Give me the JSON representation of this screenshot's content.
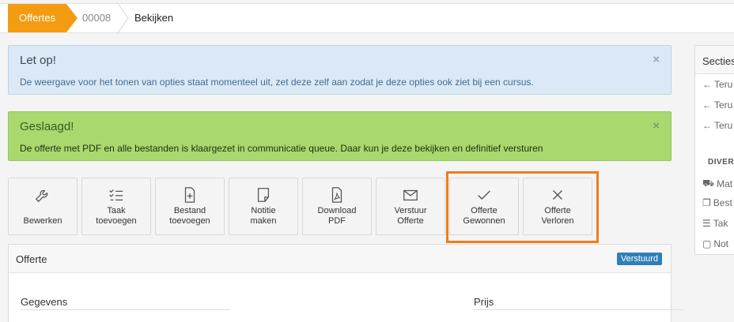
{
  "breadcrumb": {
    "first": "Offertes",
    "second": "00008",
    "third": "Bekijken"
  },
  "alerts": {
    "info": {
      "title": "Let op!",
      "text": "De weergave voor het tonen van opties staat momenteel uit, zet deze zelf aan zodat je deze opties ook ziet bij een cursus.",
      "close": "×"
    },
    "success": {
      "title": "Geslaagd!",
      "text": "De offerte met PDF en alle bestanden is klaargezet in communicatie queue. Daar kun je deze bekijken en definitief versturen",
      "close": "×"
    }
  },
  "actions": [
    {
      "line1": "Bewerken",
      "line2": "",
      "icon": "wrench-icon"
    },
    {
      "line1": "Taak",
      "line2": "toevoegen",
      "icon": "checklist-icon"
    },
    {
      "line1": "Bestand",
      "line2": "toevoegen",
      "icon": "file-plus-icon"
    },
    {
      "line1": "Notitie",
      "line2": "maken",
      "icon": "note-icon"
    },
    {
      "line1": "Download",
      "line2": "PDF",
      "icon": "pdf-icon"
    },
    {
      "line1": "Verstuur",
      "line2": "Offerte",
      "icon": "envelope-icon"
    },
    {
      "line1": "Offerte",
      "line2": "Gewonnen",
      "icon": "check-icon"
    },
    {
      "line1": "Offerte",
      "line2": "Verloren",
      "icon": "x-icon"
    }
  ],
  "panel": {
    "title": "Offerte",
    "status": "Verstuurd",
    "left_heading": "Gegevens",
    "right_heading": "Prijs"
  },
  "sidebar": {
    "title": "Secties",
    "back_items": [
      "Teru",
      "Teru",
      "Teru"
    ],
    "section_title": "DIVER",
    "items": [
      "Mat",
      "Best",
      "Tak",
      "Not"
    ]
  },
  "colors": {
    "accent": "#f39c12",
    "highlight": "#f07d19",
    "badge": "#2f7fb7",
    "success": "#a9d86e",
    "info": "#dae9f5"
  }
}
